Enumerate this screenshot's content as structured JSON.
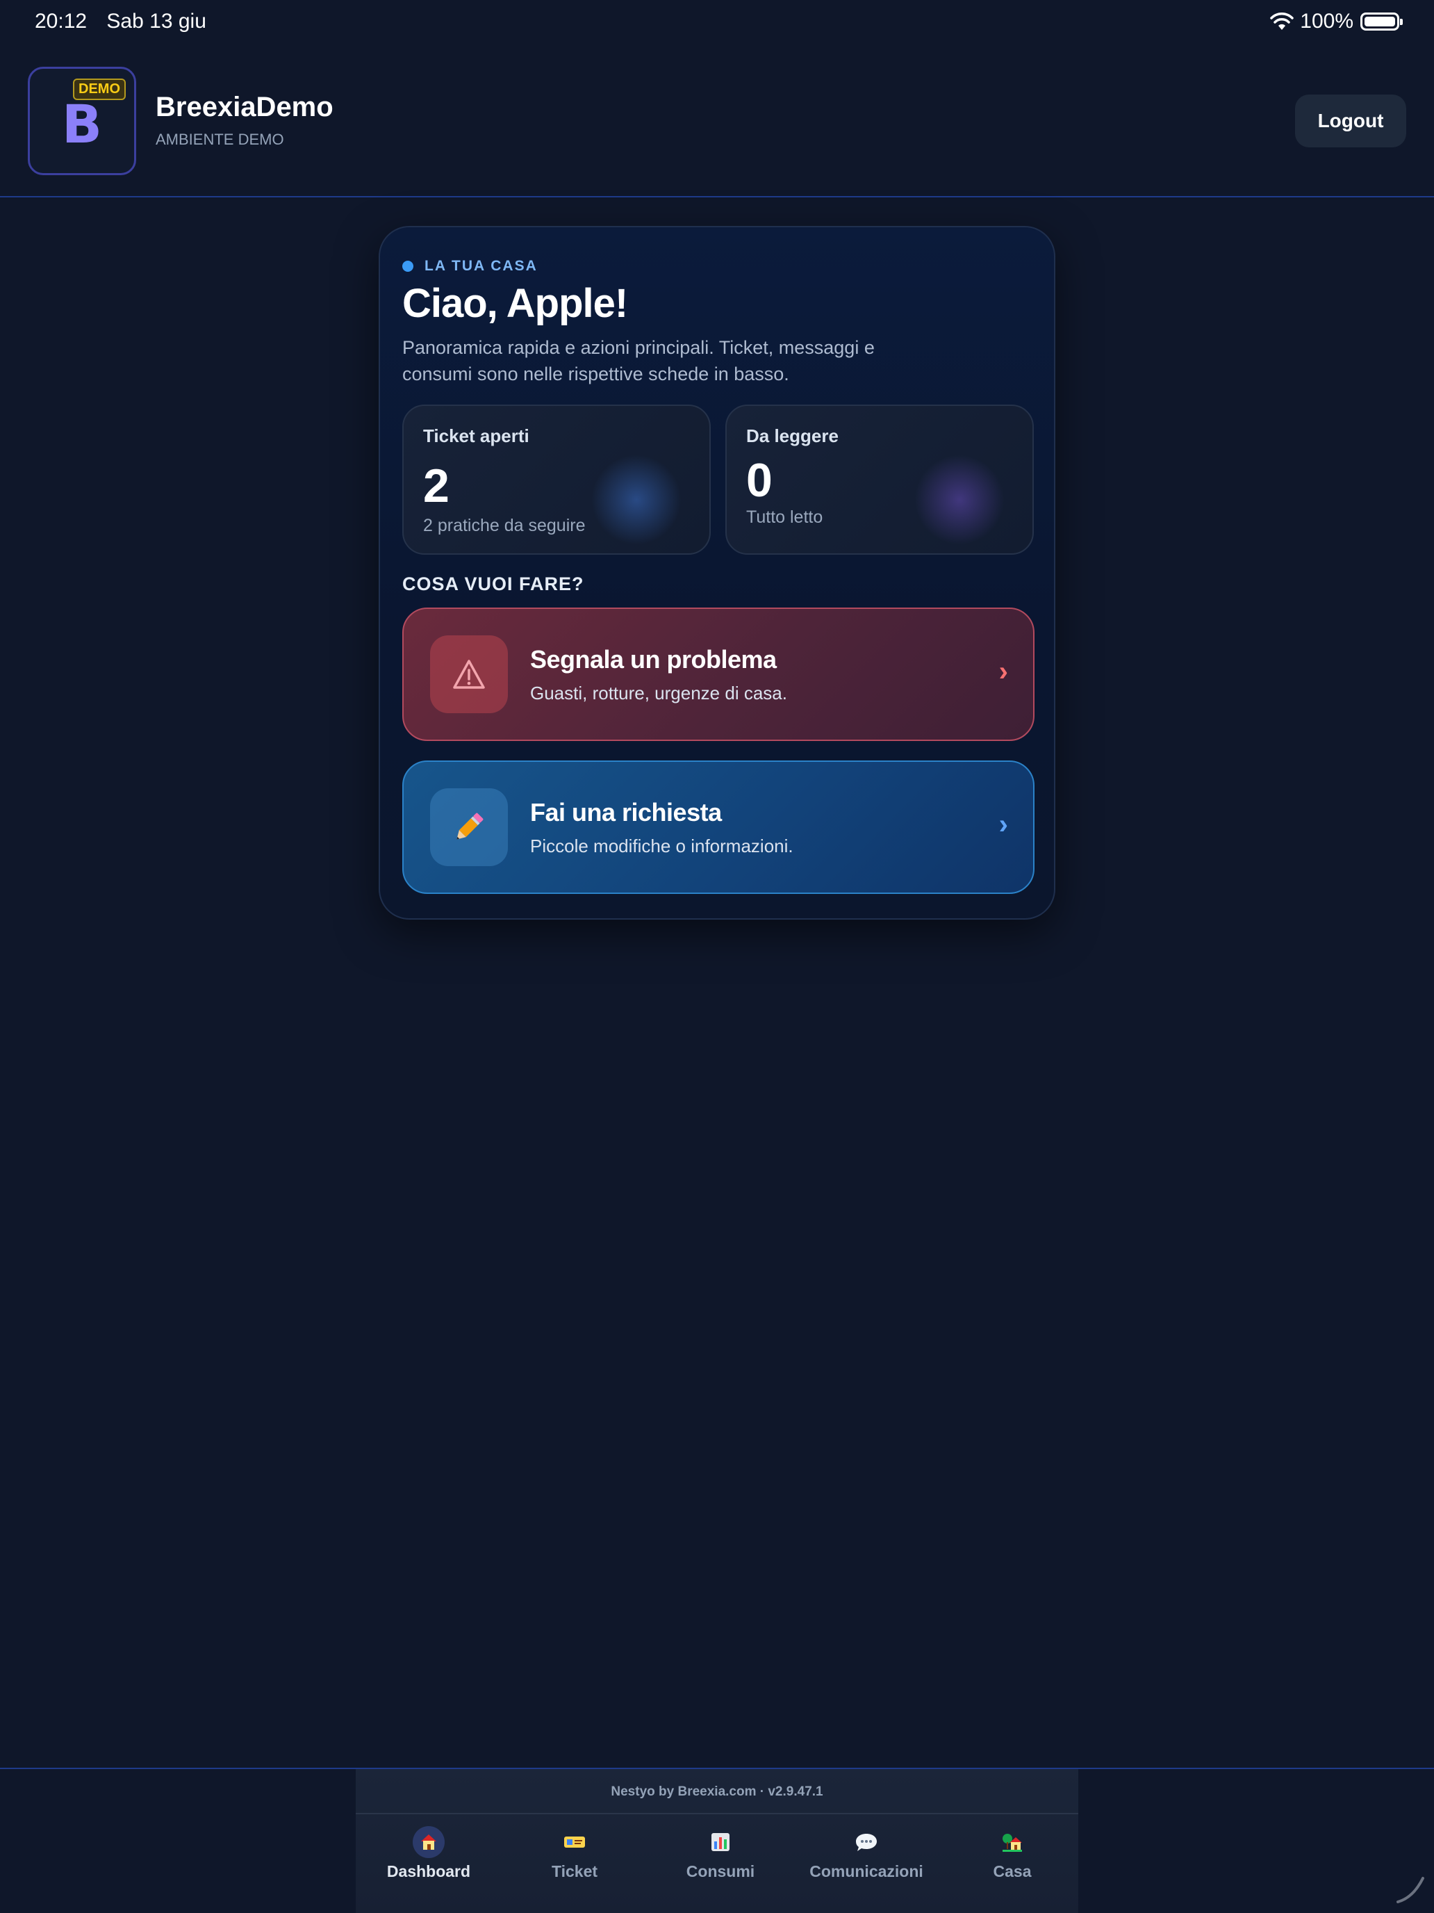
{
  "status_bar": {
    "time": "20:12",
    "date": "Sab 13 giu",
    "battery": "100%"
  },
  "header": {
    "logo_letter": "B",
    "demo_badge": "DEMO",
    "title": "BreexiaDemo",
    "subtitle": "AMBIENTE DEMO",
    "logout_label": "Logout"
  },
  "home": {
    "eyebrow": "LA TUA CASA",
    "greeting": "Ciao, Apple!",
    "intro": "Panoramica rapida e azioni principali. Ticket, messaggi e consumi sono nelle rispettive schede in basso.",
    "stats": [
      {
        "label": "Ticket aperti",
        "value": "2",
        "note": "2 pratiche da seguire"
      },
      {
        "label": "Da leggere",
        "value": "0",
        "note": "Tutto letto"
      }
    ],
    "section_title": "COSA VUOI FARE?",
    "actions": [
      {
        "title": "Segnala un problema",
        "subtitle": "Guasti, rotture, urgenze di casa.",
        "icon": "warning-icon",
        "color": "#b24a5e"
      },
      {
        "title": "Fai una richiesta",
        "subtitle": "Piccole modifiche o informazioni.",
        "icon": "pencil-icon",
        "color": "#2b82c8"
      }
    ]
  },
  "bottom_nav": {
    "footer": "Nestyo by Breexia.com · v2.9.47.1",
    "items": [
      {
        "label": "Dashboard",
        "icon": "house-icon",
        "active": true
      },
      {
        "label": "Ticket",
        "icon": "ticket-icon",
        "active": false
      },
      {
        "label": "Consumi",
        "icon": "bar-chart-icon",
        "active": false
      },
      {
        "label": "Comunicazioni",
        "icon": "speech-bubble-icon",
        "active": false
      },
      {
        "label": "Casa",
        "icon": "house-garden-icon",
        "active": false
      }
    ]
  },
  "colors": {
    "background": "#0f172a",
    "accent": "#3b9bf6",
    "brand": "#8b80f9"
  }
}
